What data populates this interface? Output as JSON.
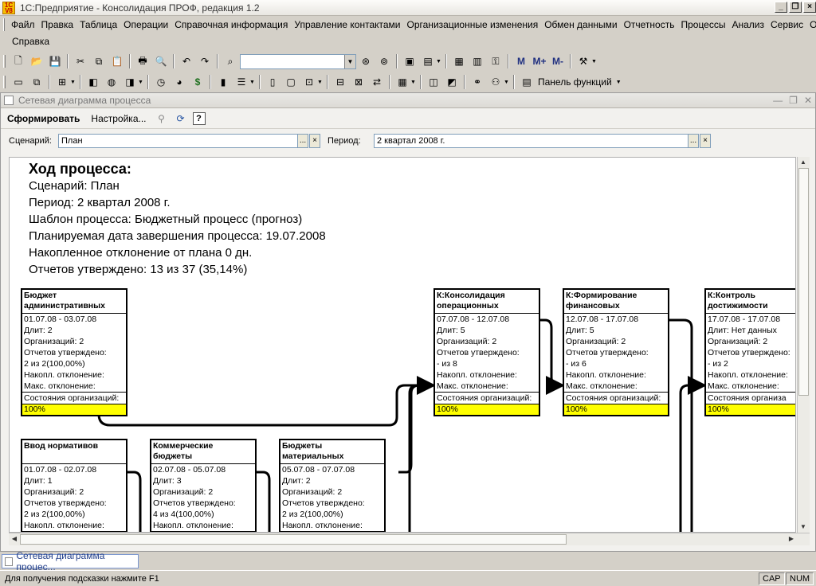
{
  "window": {
    "title": "1С:Предприятие - Консолидация ПРОФ, редакция 1.2",
    "controls": [
      "_",
      "❐",
      "×"
    ]
  },
  "menu": {
    "row1": [
      "Файл",
      "Правка",
      "Таблица",
      "Операции",
      "Справочная информация",
      "Управление контактами",
      "Организационные изменения",
      "Обмен данными",
      "Отчетность",
      "Процессы",
      "Анализ",
      "Сервис",
      "Окна"
    ],
    "row2": [
      "Справка"
    ]
  },
  "toolbar": {
    "functions_panel_label": "Панель функций",
    "search_value": ""
  },
  "document": {
    "title": "Сетевая диаграмма процесса",
    "cmd_generate": "Сформировать",
    "cmd_settings": "Настройка...",
    "cmd_help": "?",
    "scenario_label": "Сценарий:",
    "scenario_value": "План",
    "period_label": "Период:",
    "period_value": "2 квартал 2008 г.",
    "field_button": "...",
    "clear_button": "×"
  },
  "report": {
    "title": "Ход процесса:",
    "lines": [
      "Сценарий: План",
      "Период: 2 квартал 2008 г.",
      "Шаблон процесса: Бюджетный процесс (прогноз)",
      "Планируемая дата завершения процесса: 19.07.2008",
      "Накопленное отклонение от плана 0 дн.",
      "Отчетов утверждено: 13 из 37 (35,14%)"
    ],
    "nodes": [
      {
        "title": [
          "Бюджет",
          "административных"
        ],
        "rows": [
          "01.07.08 - 03.07.08",
          "Длит: 2",
          "Организаций: 2",
          "Отчетов утверждено:",
          "2 из 2(100,00%)",
          "Накопл. отклонение:",
          "Макс. отклонение:"
        ],
        "state": "Состояния организаций:",
        "bar": "100%"
      },
      {
        "title": [
          "К:Консолидация",
          "операционных"
        ],
        "rows": [
          "07.07.08 - 12.07.08",
          "Длит: 5",
          "Организаций: 2",
          "Отчетов утверждено:",
          " -  из 8",
          "Накопл. отклонение:",
          "Макс. отклонение:"
        ],
        "state": "Состояния организаций:",
        "bar": "100%"
      },
      {
        "title": [
          "К:Формирование",
          "финансовых"
        ],
        "rows": [
          "12.07.08 - 17.07.08",
          "Длит: 5",
          "Организаций: 2",
          "Отчетов утверждено:",
          " -  из 6",
          "Накопл. отклонение:",
          "Макс. отклонение:"
        ],
        "state": "Состояния организаций:",
        "bar": "100%"
      },
      {
        "title": [
          "К:Контроль",
          "достижимости"
        ],
        "rows": [
          "17.07.08 - 17.07.08",
          "Длит: Нет данных",
          "Организаций: 2",
          "Отчетов утверждено:",
          " -  из 2",
          "Накопл. отклонение:",
          "Макс. отклонение:"
        ],
        "state": "Состояния организа",
        "bar": "100%"
      },
      {
        "title": [
          "Ввод нормативов",
          ""
        ],
        "rows": [
          "01.07.08 - 02.07.08",
          "Длит: 1",
          "Организаций: 2",
          "Отчетов утверждено:",
          "2 из 2(100,00%)",
          "Накопл. отклонение:"
        ],
        "state": "",
        "bar": ""
      },
      {
        "title": [
          "Коммерческие",
          "бюджеты"
        ],
        "rows": [
          "02.07.08 - 05.07.08",
          "Длит: 3",
          "Организаций: 2",
          "Отчетов утверждено:",
          "4 из 4(100,00%)",
          "Накопл. отклонение:"
        ],
        "state": "",
        "bar": ""
      },
      {
        "title": [
          "Бюджеты",
          "материальных"
        ],
        "rows": [
          "05.07.08 - 07.07.08",
          "Длит: 2",
          "Организаций: 2",
          "Отчетов утверждено:",
          "2 из 2(100,00%)",
          "Накопл. отклонение:"
        ],
        "state": "",
        "bar": ""
      }
    ]
  },
  "taskbar": {
    "tab": "Сетевая диаграмма процес..."
  },
  "status": {
    "hint": "Для получения подсказки нажмите F1",
    "cap": "CAP",
    "num": "NUM"
  },
  "colors": {
    "progress_fill": "#ffff00",
    "task_text": "#25418b"
  }
}
